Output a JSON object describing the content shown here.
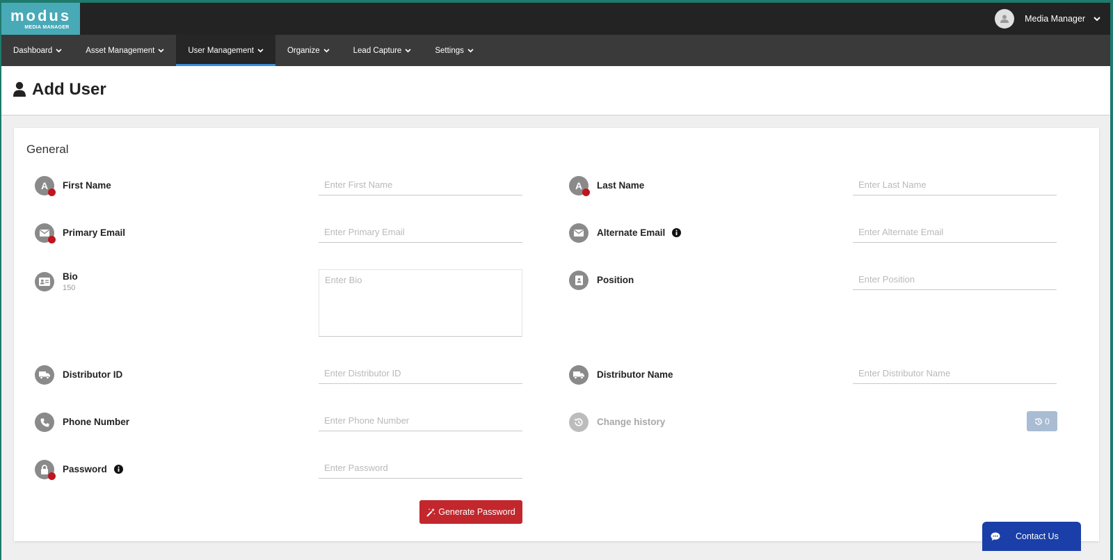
{
  "logo": {
    "word": "modus",
    "sub": "MEDIA MANAGER"
  },
  "user": {
    "name": "Media Manager"
  },
  "nav": [
    {
      "label": "Dashboard",
      "active": false
    },
    {
      "label": "Asset Management",
      "active": false
    },
    {
      "label": "User Management",
      "active": true
    },
    {
      "label": "Organize",
      "active": false
    },
    {
      "label": "Lead Capture",
      "active": false
    },
    {
      "label": "Settings",
      "active": false
    }
  ],
  "page": {
    "title": "Add User"
  },
  "form": {
    "section": "General",
    "first_name": {
      "label": "First Name",
      "placeholder": "Enter First Name",
      "required": true
    },
    "last_name": {
      "label": "Last Name",
      "placeholder": "Enter Last Name",
      "required": true
    },
    "primary_email": {
      "label": "Primary Email",
      "placeholder": "Enter Primary Email",
      "required": true
    },
    "alternate_email": {
      "label": "Alternate Email",
      "placeholder": "Enter Alternate Email",
      "required": false
    },
    "bio": {
      "label": "Bio",
      "counter": "150",
      "placeholder": "Enter Bio"
    },
    "position": {
      "label": "Position",
      "placeholder": "Enter Position"
    },
    "distributor_id": {
      "label": "Distributor ID",
      "placeholder": "Enter Distributor ID"
    },
    "distributor_name": {
      "label": "Distributor Name",
      "placeholder": "Enter Distributor Name"
    },
    "phone": {
      "label": "Phone Number",
      "placeholder": "Enter Phone Number"
    },
    "change_history": {
      "label": "Change history",
      "count": "0"
    },
    "password": {
      "label": "Password",
      "placeholder": "Enter Password",
      "required": true
    },
    "generate_button": "Generate Password"
  },
  "contact": {
    "label": "Contact Us"
  },
  "colors": {
    "accent": "#48a9b7",
    "required": "#c0141f",
    "primary_button": "#c1272d",
    "contact": "#1a3fa8",
    "nav_active": "#3a8fe0"
  }
}
